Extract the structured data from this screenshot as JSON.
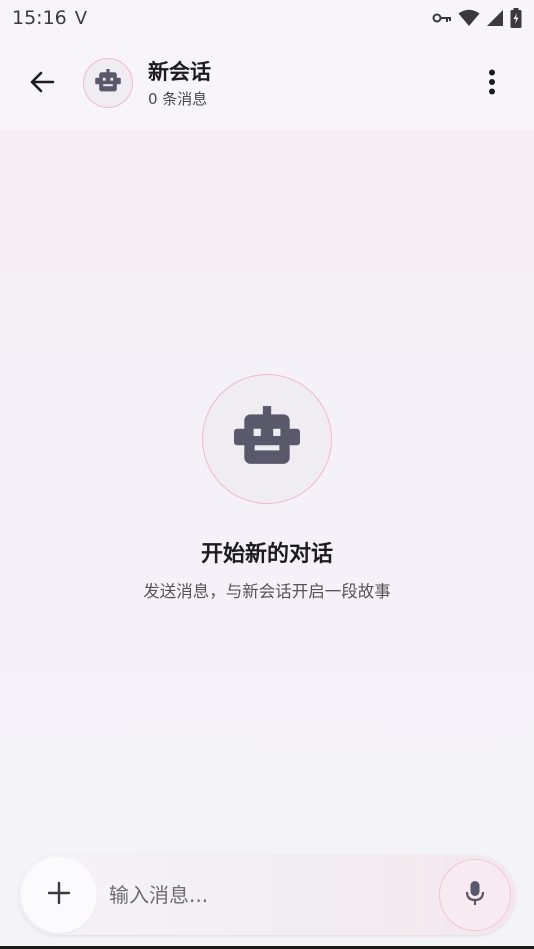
{
  "status_bar": {
    "time": "15:16",
    "carrier_icon": "V",
    "icons": [
      "vpn-key-icon",
      "wifi-icon",
      "signal-icon",
      "battery-charging-icon"
    ]
  },
  "header": {
    "back_icon": "arrow-left-icon",
    "avatar_icon": "robot-icon",
    "title": "新会话",
    "subtitle": "0 条消息",
    "menu_icon": "more-vertical-icon"
  },
  "empty_state": {
    "icon": "robot-icon",
    "title": "开始新的对话",
    "subtitle": "发送消息，与新会话开启一段故事"
  },
  "composer": {
    "add_icon": "plus-icon",
    "placeholder": "输入消息...",
    "value": "",
    "mic_icon": "microphone-icon"
  },
  "colors": {
    "background": "#f4f3f8",
    "accent_border": "#f2b8c9",
    "icon": "#5a596b"
  }
}
